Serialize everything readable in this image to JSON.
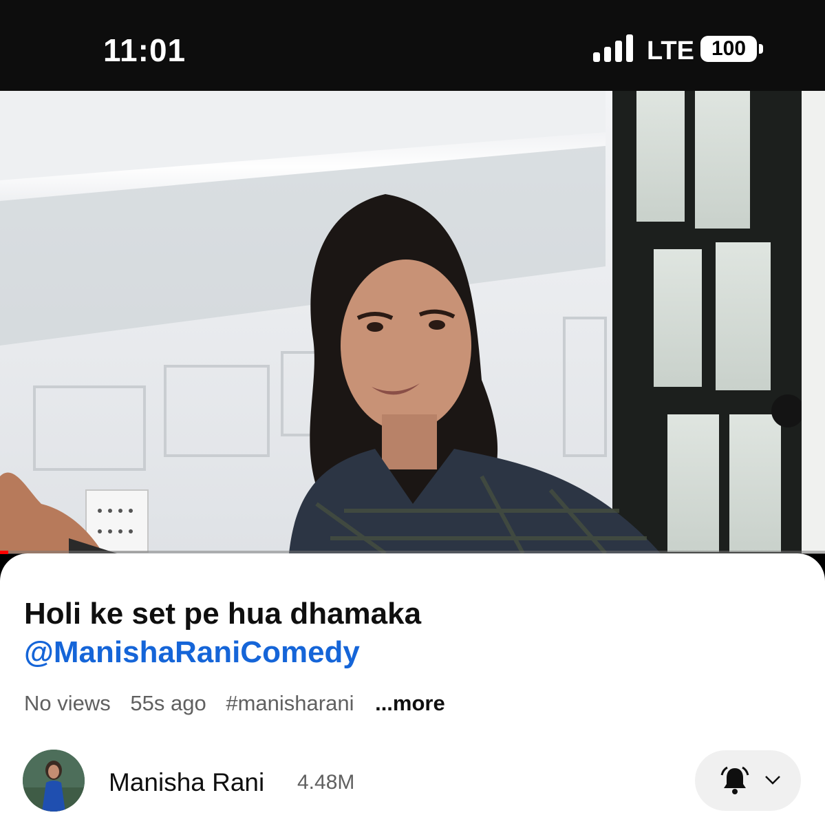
{
  "status_bar": {
    "time": "11:01",
    "network": "LTE",
    "battery": "100"
  },
  "video": {
    "progress_percent": 1
  },
  "info": {
    "title": "Holi ke set pe hua dhamaka",
    "mention": "@ManishaRaniComedy",
    "views": "No views",
    "age": "55s ago",
    "hashtag": "#manisharani",
    "more": "...more"
  },
  "channel": {
    "name": "Manisha Rani",
    "subscribers": "4.48M"
  },
  "colors": {
    "link": "#1565d8",
    "progress": "#ff0000"
  }
}
